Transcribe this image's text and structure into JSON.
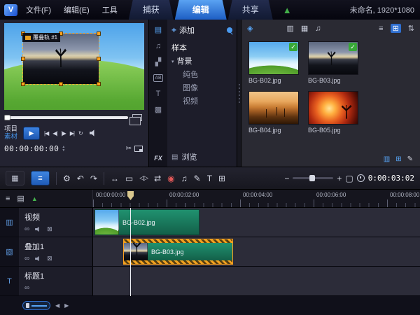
{
  "titlebar": {
    "logo": "V",
    "menus": [
      {
        "label": "文件(F)"
      },
      {
        "label": "编辑(E)"
      },
      {
        "label": "工具"
      }
    ],
    "tabs": [
      {
        "label": "捕获"
      },
      {
        "label": "编辑"
      },
      {
        "label": "共享"
      }
    ],
    "active_tab": "编辑",
    "project_info": "未命名, 1920*1080"
  },
  "preview": {
    "overlay_label": "覆叠轨 #1",
    "mode_project": "项目",
    "mode_clip": "素材",
    "timecode": "00:00:00:00"
  },
  "library": {
    "add_label": "添加",
    "browse_label": "浏览",
    "fx_label": "FX",
    "ab_label": "AB",
    "t_label": "T",
    "tree": [
      {
        "label": "样本",
        "level": 0
      },
      {
        "label": "背景",
        "level": 0,
        "expanded": true
      },
      {
        "label": "纯色",
        "level": 1
      },
      {
        "label": "图像",
        "level": 1
      },
      {
        "label": "视频",
        "level": 1
      }
    ]
  },
  "gallery": {
    "items": [
      {
        "name": "BG-B02.jpg",
        "checked": true
      },
      {
        "name": "BG-B03.jpg",
        "checked": true
      },
      {
        "name": "BG-B04.jpg",
        "checked": false
      },
      {
        "name": "BG-B05.jpg",
        "checked": false
      }
    ]
  },
  "toolbar": {
    "timecode": "0:00:03:02"
  },
  "timeline": {
    "ruler_labels": [
      "00:00:00:00",
      "00:00:02:00",
      "00:00:04:00",
      "00:00:06:00",
      "00:00:08:00"
    ],
    "tracks": [
      {
        "name": "视频",
        "clip": "BG-B02.jpg"
      },
      {
        "name": "叠加1",
        "clip": "BG-B03.jpg"
      },
      {
        "name": "标题1",
        "clip": ""
      }
    ]
  },
  "colors": {
    "accent": "#2f7ad8",
    "tab_active": "#3f86e2",
    "selection_orange": "#ffa21f",
    "clip_green": "#1b8066",
    "check_green": "#38a838"
  },
  "icons": {
    "up_arrow": "▲",
    "play": "▶",
    "go_start": "|◀",
    "prev_frame": "◀|",
    "next_frame": "|▶",
    "go_end": "▶|",
    "loop": "↻",
    "scissors": "✂",
    "spin_up": "▲",
    "spin_down": "▼",
    "add": "+",
    "expand": "▾",
    "media": "▤",
    "audio": "♫",
    "transition": "▞",
    "overlay": "▩",
    "browse": "▤",
    "check": "✓",
    "smart": "◈",
    "filter_video": "▥",
    "filter_photo": "▦",
    "filter_audio": "♫",
    "list": "≡",
    "grid": "⊞",
    "sort": "⇅",
    "storyboard": "▦",
    "timeline": "≡",
    "tools": "⚙",
    "undo": "↶",
    "redo": "↷",
    "trim": "↔",
    "crop": "▭",
    "split": "◁▷",
    "swap": "⇄",
    "record": "◉",
    "mixer": "♫",
    "paint": "✎",
    "subtitle": "T",
    "template": "⊞",
    "zoom_out": "−",
    "zoom_in": "+",
    "fit": "▢",
    "track_list": "≡",
    "track_media": "▤",
    "track_add": "▲",
    "track_video": "▥",
    "track_overlay": "▧",
    "track_title": "T",
    "link": "∞",
    "exclude": "⊠",
    "left": "◀",
    "right": "▶",
    "panel_a": "▥",
    "panel_b": "⊞",
    "pencil": "✎"
  }
}
